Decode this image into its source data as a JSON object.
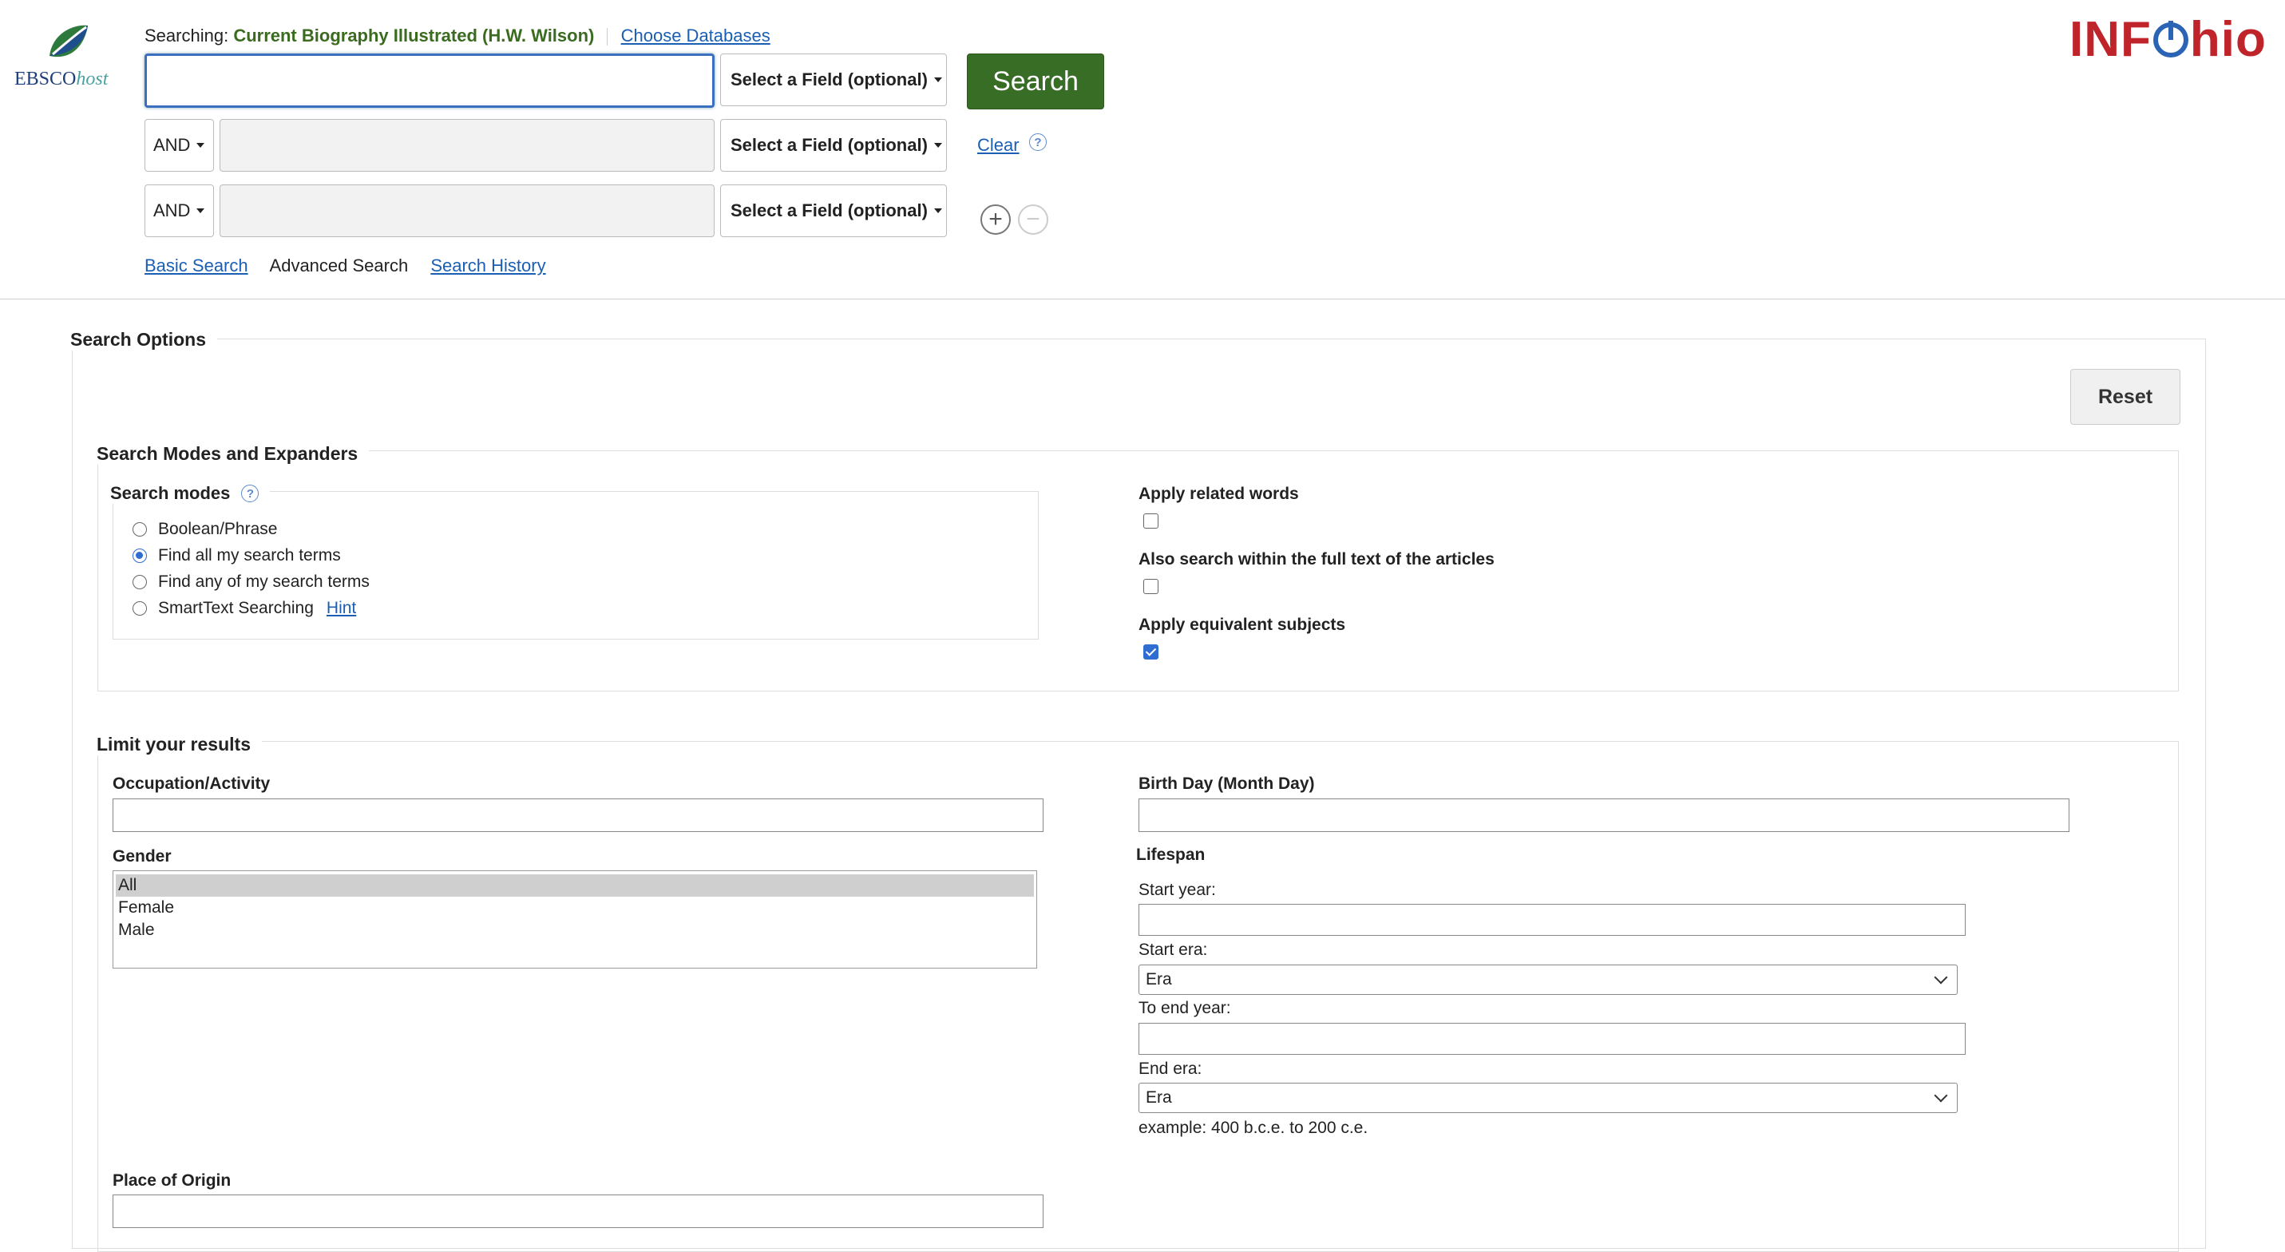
{
  "header": {
    "searching_prefix": "Searching:",
    "database": "Current Biography Illustrated (H.W. Wilson)",
    "choose_databases": "Choose Databases",
    "ebsco_logo": "EBSCO",
    "ebsco_logo_suffix": "host",
    "infohio_logo_left": "INF",
    "infohio_logo_right": "hio"
  },
  "query_rows": [
    {
      "operator": "",
      "value": "",
      "field": "Select a Field (optional)"
    },
    {
      "operator": "AND",
      "value": "",
      "field": "Select a Field (optional)"
    },
    {
      "operator": "AND",
      "value": "",
      "field": "Select a Field (optional)"
    }
  ],
  "search_button": "Search",
  "clear_link": "Clear",
  "help_glyph": "?",
  "add_glyph": "+",
  "remove_glyph": "−",
  "nav": {
    "basic": "Basic Search",
    "advanced": "Advanced Search",
    "history": "Search History"
  },
  "options": {
    "title": "Search Options",
    "reset": "Reset",
    "modes_section": "Search Modes and Expanders",
    "modes_label": "Search modes",
    "modes": [
      {
        "label": "Boolean/Phrase",
        "selected": false
      },
      {
        "label": "Find all my search terms",
        "selected": true
      },
      {
        "label": "Find any of my search terms",
        "selected": false
      },
      {
        "label": "SmartText Searching",
        "selected": false
      }
    ],
    "hint": "Hint",
    "expanders": [
      {
        "label": "Apply related words",
        "checked": false
      },
      {
        "label": "Also search within the full text of the articles",
        "checked": false
      },
      {
        "label": "Apply equivalent subjects",
        "checked": true
      }
    ]
  },
  "limits": {
    "title": "Limit your results",
    "occupation_label": "Occupation/Activity",
    "birthday_label": "Birth Day (Month Day)",
    "gender_label": "Gender",
    "gender_options": [
      "All",
      "Female",
      "Male"
    ],
    "gender_selected": "All",
    "lifespan_label": "Lifespan",
    "start_year_label": "Start year:",
    "start_era_label": "Start era:",
    "start_era_value": "Era",
    "end_year_label": "To end year:",
    "end_era_label": "End era:",
    "end_era_value": "Era",
    "example": "example: 400 b.c.e. to 200 c.e.",
    "origin_label": "Place of Origin"
  },
  "colors": {
    "search_button": "#386d26",
    "database_text": "#3a6b1f",
    "link": "#1a5fb4",
    "infohio_red": "#c0242b",
    "infohio_blue": "#2c64b5"
  }
}
